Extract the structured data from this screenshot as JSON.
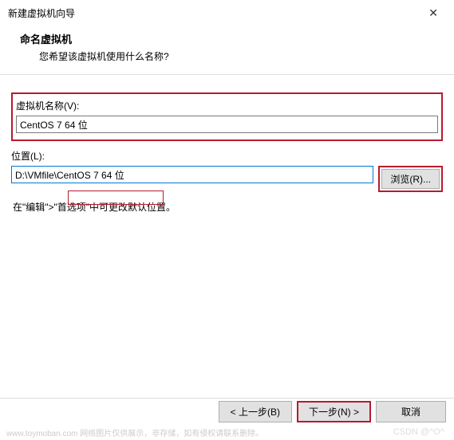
{
  "titlebar": {
    "title": "新建虚拟机向导",
    "close": "✕"
  },
  "header": {
    "title": "命名虚拟机",
    "subtitle": "您希望该虚拟机使用什么名称?"
  },
  "form": {
    "vm_name_label": "虚拟机名称(V):",
    "vm_name_value": "CentOS 7 64 位",
    "location_label": "位置(L):",
    "location_value": "D:\\VMfile\\CentOS 7 64 位",
    "browse_label": "浏览(R)...",
    "hint": "在\"编辑\">\"首选项\"中可更改默认位置。"
  },
  "footer": {
    "back": "< 上一步(B)",
    "next": "下一步(N) >",
    "cancel": "取消"
  },
  "watermark": {
    "left": "www.toymoban.com  网络图片仅供展示，非存储，如有侵权请联系删除。",
    "right": "CSDN @^O^"
  }
}
